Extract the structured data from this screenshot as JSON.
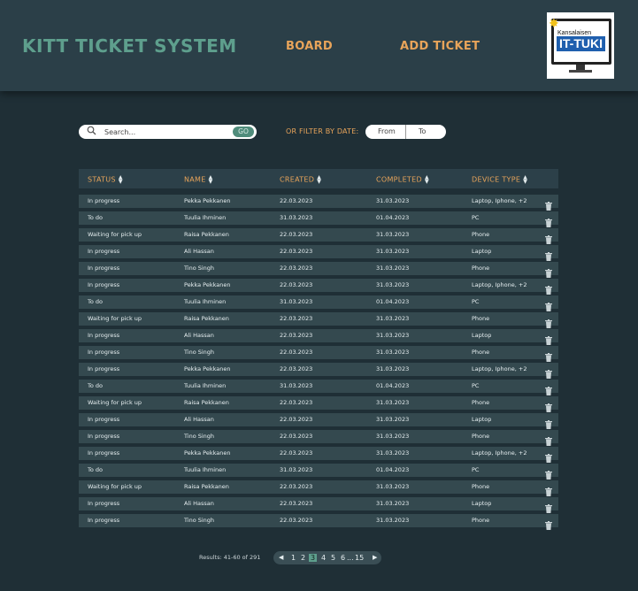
{
  "header": {
    "brand": "KITT TICKET SYSTEM",
    "nav": {
      "board": "BOARD",
      "add_ticket": "ADD TICKET"
    },
    "logo": {
      "small_text": "Kansalaisen",
      "big_text": "IT-TUKI"
    }
  },
  "search": {
    "placeholder": "Search...",
    "button": "GO"
  },
  "filter": {
    "label": "OR FILTER BY DATE:",
    "from": "From",
    "to": "To"
  },
  "table": {
    "columns": [
      "STATUS",
      "NAME",
      "CREATED",
      "COMPLETED",
      "DEVICE TYPE"
    ],
    "rows": [
      [
        "In progress",
        "Pekka Pekkanen",
        "22.03.2023",
        "31.03.2023",
        "Laptop, Iphone, +2"
      ],
      [
        "To do",
        "Tuulia Ihminen",
        "31.03.2023",
        "01.04.2023",
        "PC"
      ],
      [
        "Waiting for pick up",
        "Raisa Pekkanen",
        "22.03.2023",
        "31.03.2023",
        "Phone"
      ],
      [
        "In progress",
        "Ali Hassan",
        "22.03.2023",
        "31.03.2023",
        "Laptop"
      ],
      [
        "In progress",
        "Tino Singh",
        "22.03.2023",
        "31.03.2023",
        "Phone"
      ],
      [
        "In progress",
        "Pekka Pekkanen",
        "22.03.2023",
        "31.03.2023",
        "Laptop, Iphone, +2"
      ],
      [
        "To do",
        "Tuulia Ihminen",
        "31.03.2023",
        "01.04.2023",
        "PC"
      ],
      [
        "Waiting for pick up",
        "Raisa Pekkanen",
        "22.03.2023",
        "31.03.2023",
        "Phone"
      ],
      [
        "In progress",
        "Ali Hassan",
        "22.03.2023",
        "31.03.2023",
        "Laptop"
      ],
      [
        "In progress",
        "Tino Singh",
        "22.03.2023",
        "31.03.2023",
        "Phone"
      ],
      [
        "In progress",
        "Pekka Pekkanen",
        "22.03.2023",
        "31.03.2023",
        "Laptop, Iphone, +2"
      ],
      [
        "To do",
        "Tuulia Ihminen",
        "31.03.2023",
        "01.04.2023",
        "PC"
      ],
      [
        "Waiting for pick up",
        "Raisa Pekkanen",
        "22.03.2023",
        "31.03.2023",
        "Phone"
      ],
      [
        "In progress",
        "Ali Hassan",
        "22.03.2023",
        "31.03.2023",
        "Laptop"
      ],
      [
        "In progress",
        "Tino Singh",
        "22.03.2023",
        "31.03.2023",
        "Phone"
      ],
      [
        "In progress",
        "Pekka Pekkanen",
        "22.03.2023",
        "31.03.2023",
        "Laptop, Iphone, +2"
      ],
      [
        "To do",
        "Tuulia Ihminen",
        "31.03.2023",
        "01.04.2023",
        "PC"
      ],
      [
        "Waiting for pick up",
        "Raisa Pekkanen",
        "22.03.2023",
        "31.03.2023",
        "Phone"
      ],
      [
        "In progress",
        "Ali Hassan",
        "22.03.2023",
        "31.03.2023",
        "Laptop"
      ],
      [
        "In progress",
        "Tino Singh",
        "22.03.2023",
        "31.03.2023",
        "Phone"
      ]
    ]
  },
  "pagination": {
    "results": "Results: 41-60 of 291",
    "prev": "◀",
    "pages": [
      "1",
      "2",
      "3",
      "4",
      "5",
      "6",
      "...",
      "15"
    ],
    "current": "3",
    "next": "▶"
  },
  "colors": {
    "background": "#1f2f36",
    "header": "#2b3f48",
    "brand": "#5e9f8d",
    "accent": "#e8a45a",
    "row": "#34494f",
    "active_page": "#5e9f8d"
  },
  "icons": {
    "search": "search-icon",
    "sort": "sort-icon",
    "delete": "trash-icon",
    "prev": "chevron-left-icon",
    "next": "chevron-right-icon"
  }
}
